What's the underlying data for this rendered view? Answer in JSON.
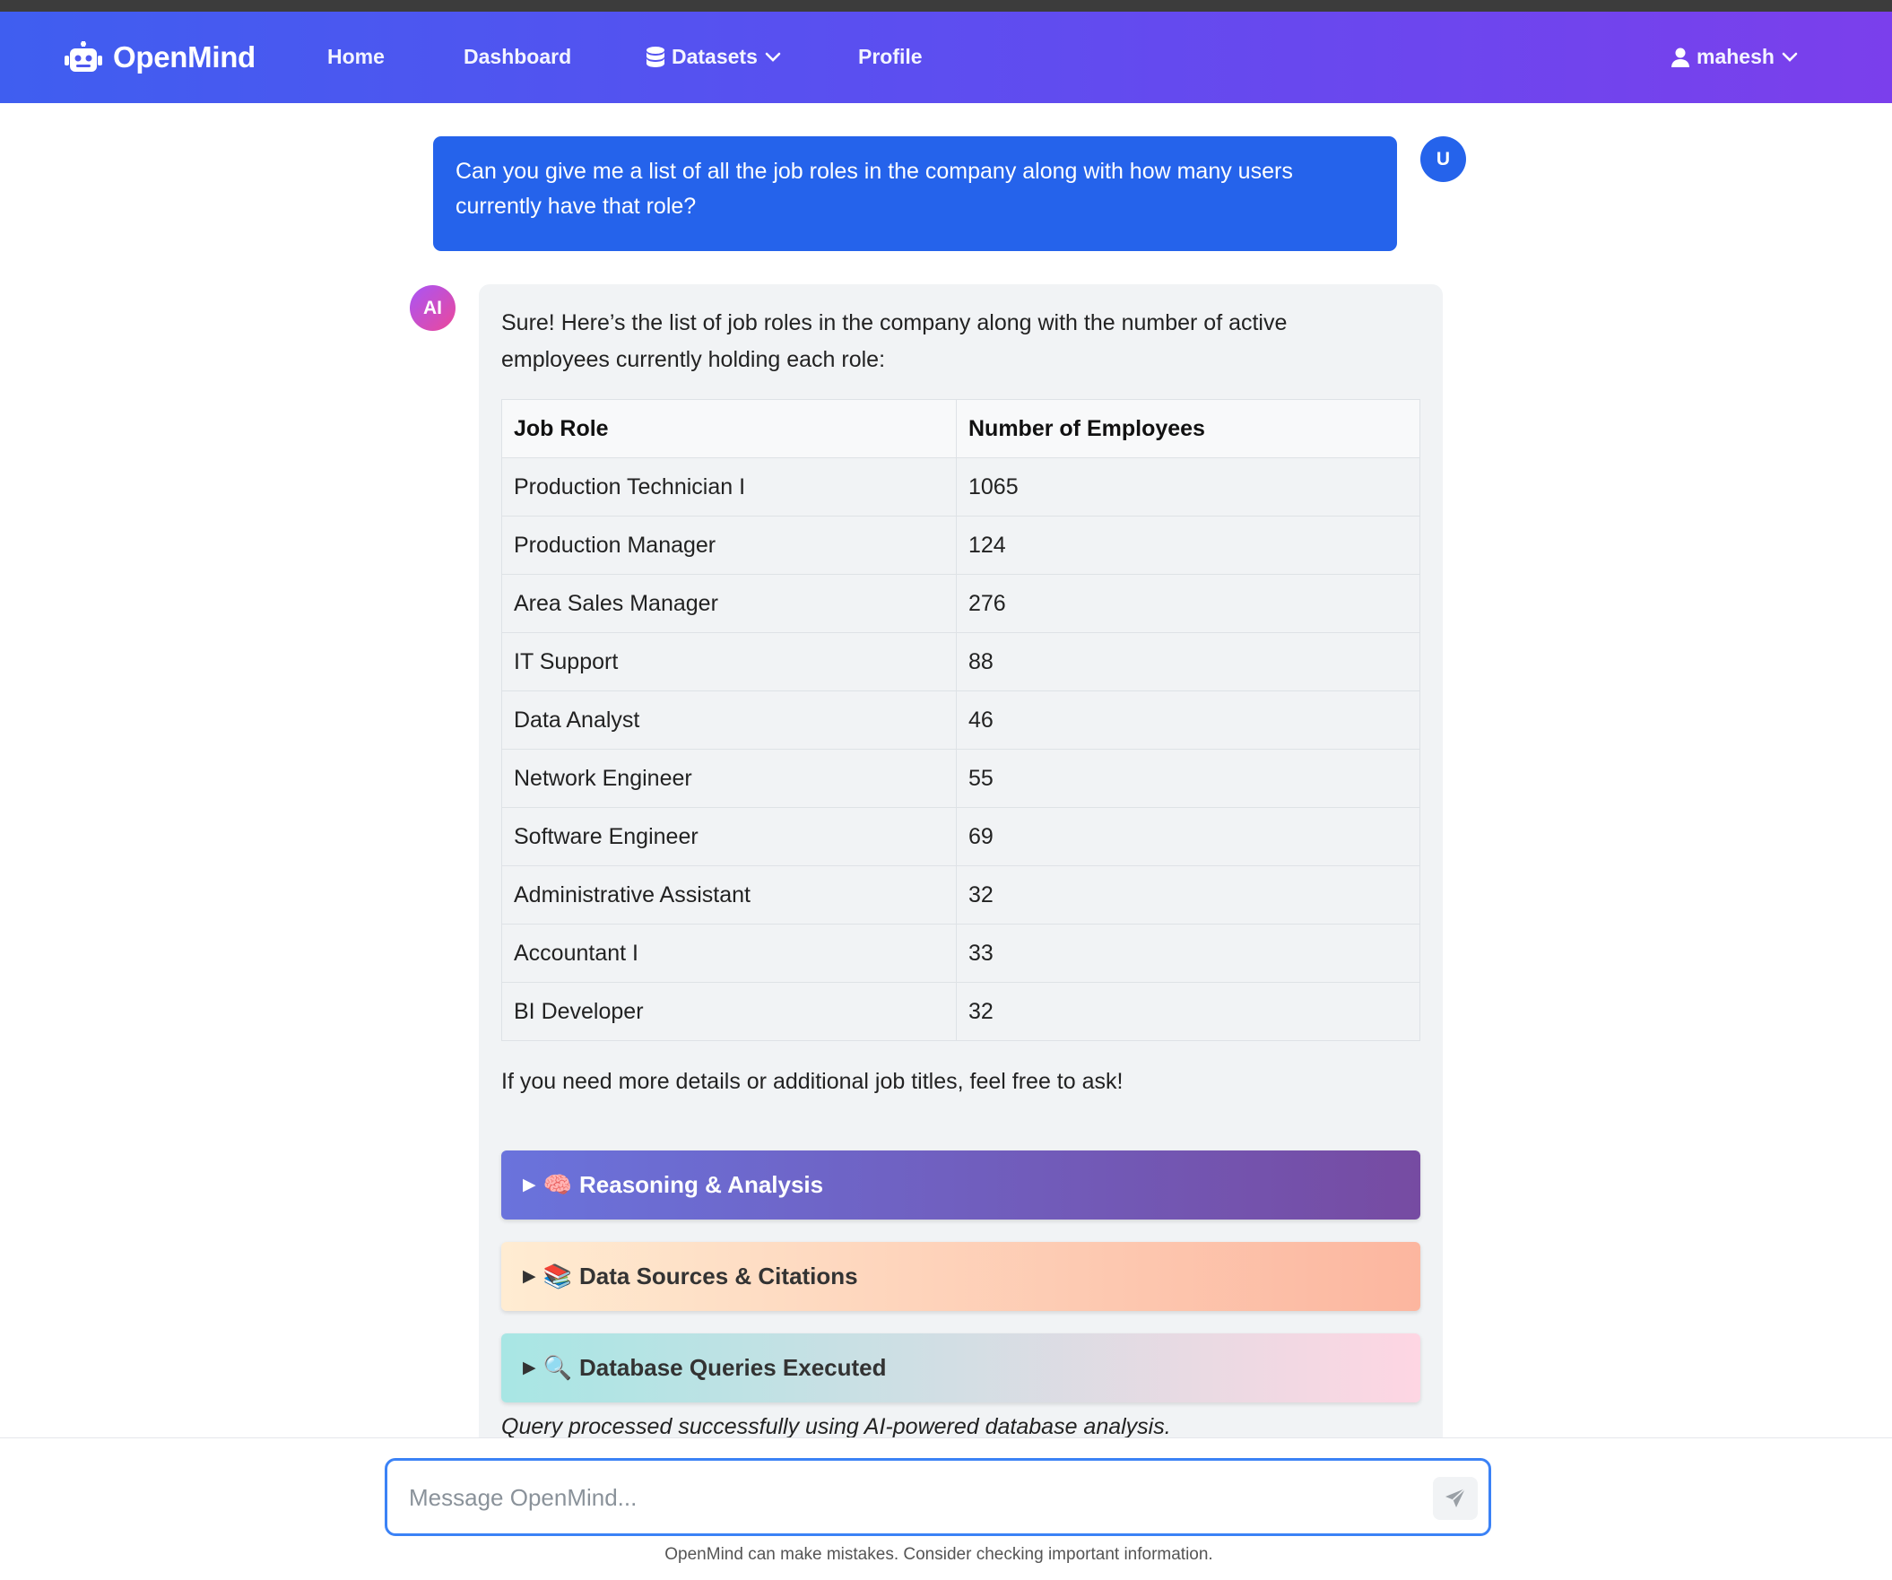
{
  "app": {
    "name": "OpenMind",
    "icon": "robot-icon"
  },
  "nav": {
    "home": "Home",
    "dashboard": "Dashboard",
    "datasets": "Datasets",
    "profile": "Profile",
    "user": "mahesh"
  },
  "chat": {
    "user_avatar": "U",
    "ai_avatar": "AI",
    "user_message": "Can you give me a list of all the job roles in the company along with how many users currently have that role?",
    "ai_intro": "Sure! Here’s the list of job roles in the company along with the number of active employees currently holding each role:",
    "table": {
      "headers": [
        "Job Role",
        "Number of Employees"
      ],
      "rows": [
        [
          "Production Technician I",
          "1065"
        ],
        [
          "Production Manager",
          "124"
        ],
        [
          "Area Sales Manager",
          "276"
        ],
        [
          "IT Support",
          "88"
        ],
        [
          "Data Analyst",
          "46"
        ],
        [
          "Network Engineer",
          "55"
        ],
        [
          "Software Engineer",
          "69"
        ],
        [
          "Administrative Assistant",
          "32"
        ],
        [
          "Accountant I",
          "33"
        ],
        [
          "BI Developer",
          "32"
        ]
      ]
    },
    "ai_outro": "If you need more details or additional job titles, feel free to ask!",
    "sections": {
      "reasoning": {
        "caret": "▶",
        "emoji": "🧠",
        "label": "Reasoning & Analysis"
      },
      "sources": {
        "caret": "▶",
        "emoji": "📚",
        "label": "Data Sources & Citations"
      },
      "queries": {
        "caret": "▶",
        "emoji": "🔍",
        "label": "Database Queries Executed"
      }
    },
    "status_note": "Query processed successfully using AI-powered database analysis."
  },
  "composer": {
    "placeholder": "Message OpenMind...",
    "value": "",
    "send_icon": "send-icon",
    "disclaimer": "OpenMind can make mistakes. Consider checking important information."
  },
  "colors": {
    "navbar_start": "#3f5ef0",
    "navbar_end": "#7b3fec",
    "user_bubble": "#2563eb",
    "input_border": "#3b82f6"
  }
}
